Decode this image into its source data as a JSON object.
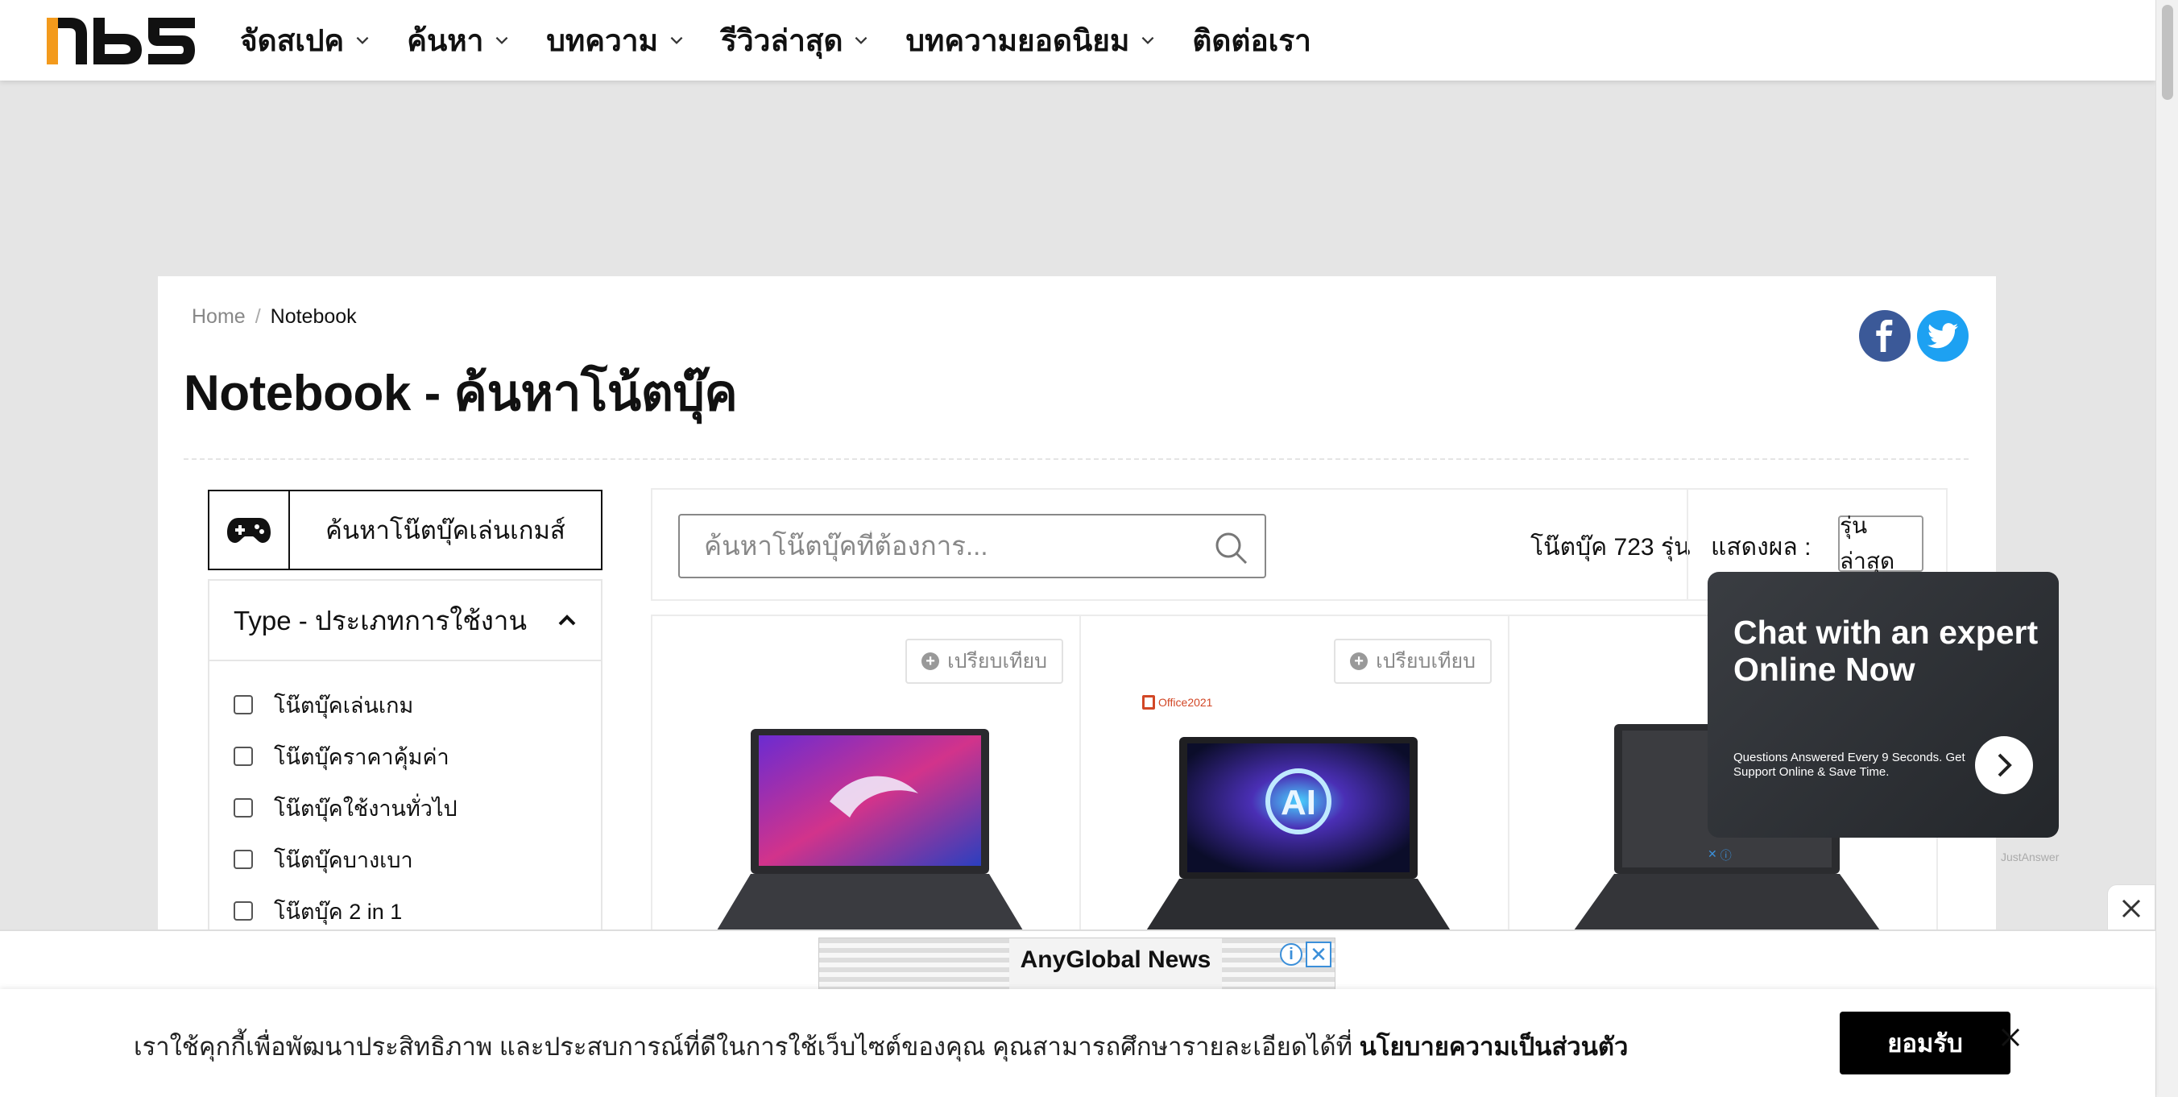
{
  "brand": {
    "logo_text": "nBS"
  },
  "nav": {
    "items": [
      {
        "label": "จัดสเปค",
        "has_dropdown": true
      },
      {
        "label": "ค้นหา",
        "has_dropdown": true
      },
      {
        "label": "บทความ",
        "has_dropdown": true
      },
      {
        "label": "รีวิวล่าสุด",
        "has_dropdown": true
      },
      {
        "label": "บทความยอดนิยม",
        "has_dropdown": true
      },
      {
        "label": "ติดต่อเรา",
        "has_dropdown": false
      }
    ]
  },
  "breadcrumb": {
    "home": "Home",
    "separator": "/",
    "current": "Notebook"
  },
  "page": {
    "title": "Notebook - ค้นหาโน้ตบุ๊ค"
  },
  "social": {
    "facebook": "facebook-icon",
    "twitter": "twitter-icon"
  },
  "filters": {
    "gaming_button_label": "ค้นหาโน๊ตบุ๊คเล่นเกมส์",
    "type_header": "Type - ประเภทการใช้งาน",
    "type_options": [
      {
        "label": "โน๊ตบุ๊คเล่นเกม",
        "checked": false
      },
      {
        "label": "โน๊ตบุ๊คราคาคุ้มค่า",
        "checked": false
      },
      {
        "label": "โน๊ตบุ๊คใช้งานทั่วไป",
        "checked": false
      },
      {
        "label": "โน๊ตบุ๊คบางเบา",
        "checked": false
      },
      {
        "label": "โน๊ตบุ๊ค 2 in 1",
        "checked": false
      }
    ]
  },
  "search": {
    "placeholder": "ค้นหาโน๊ตบุ๊คที่ต้องการ..."
  },
  "results": {
    "count_text": "โน๊ตบุ๊ค 723 รุ่น",
    "sort_label": "แสดงผล :",
    "sort_value": "รุ่นล่าสุด"
  },
  "products": [
    {
      "compare_label": "เปรียบเทียบ",
      "badge": ""
    },
    {
      "compare_label": "เปรียบเทียบ",
      "badge": "Office2021"
    },
    {
      "compare_label": "",
      "badge": ""
    }
  ],
  "chat_ad": {
    "title": "Chat with an expert Online Now",
    "subtitle": "Questions Answered Every 9 Seconds. Get Support Online & Save Time.",
    "brand": "JustAnswer"
  },
  "bottom_ad": {
    "name": "AnyGlobal News"
  },
  "cookie": {
    "text": "เราใช้คุกกี้เพื่อพัฒนาประสิทธิภาพ และประสบการณ์ที่ดีในการใช้เว็บไซต์ของคุณ คุณสามารถศึกษารายละเอียดได้ที่ ",
    "link": "นโยบายความเป็นส่วนตัว",
    "accept": "ยอมรับ"
  },
  "colors": {
    "facebook": "#3b5998",
    "twitter": "#1da1f2",
    "page_bg": "#e5e5e5",
    "accept_bg": "#000000"
  }
}
